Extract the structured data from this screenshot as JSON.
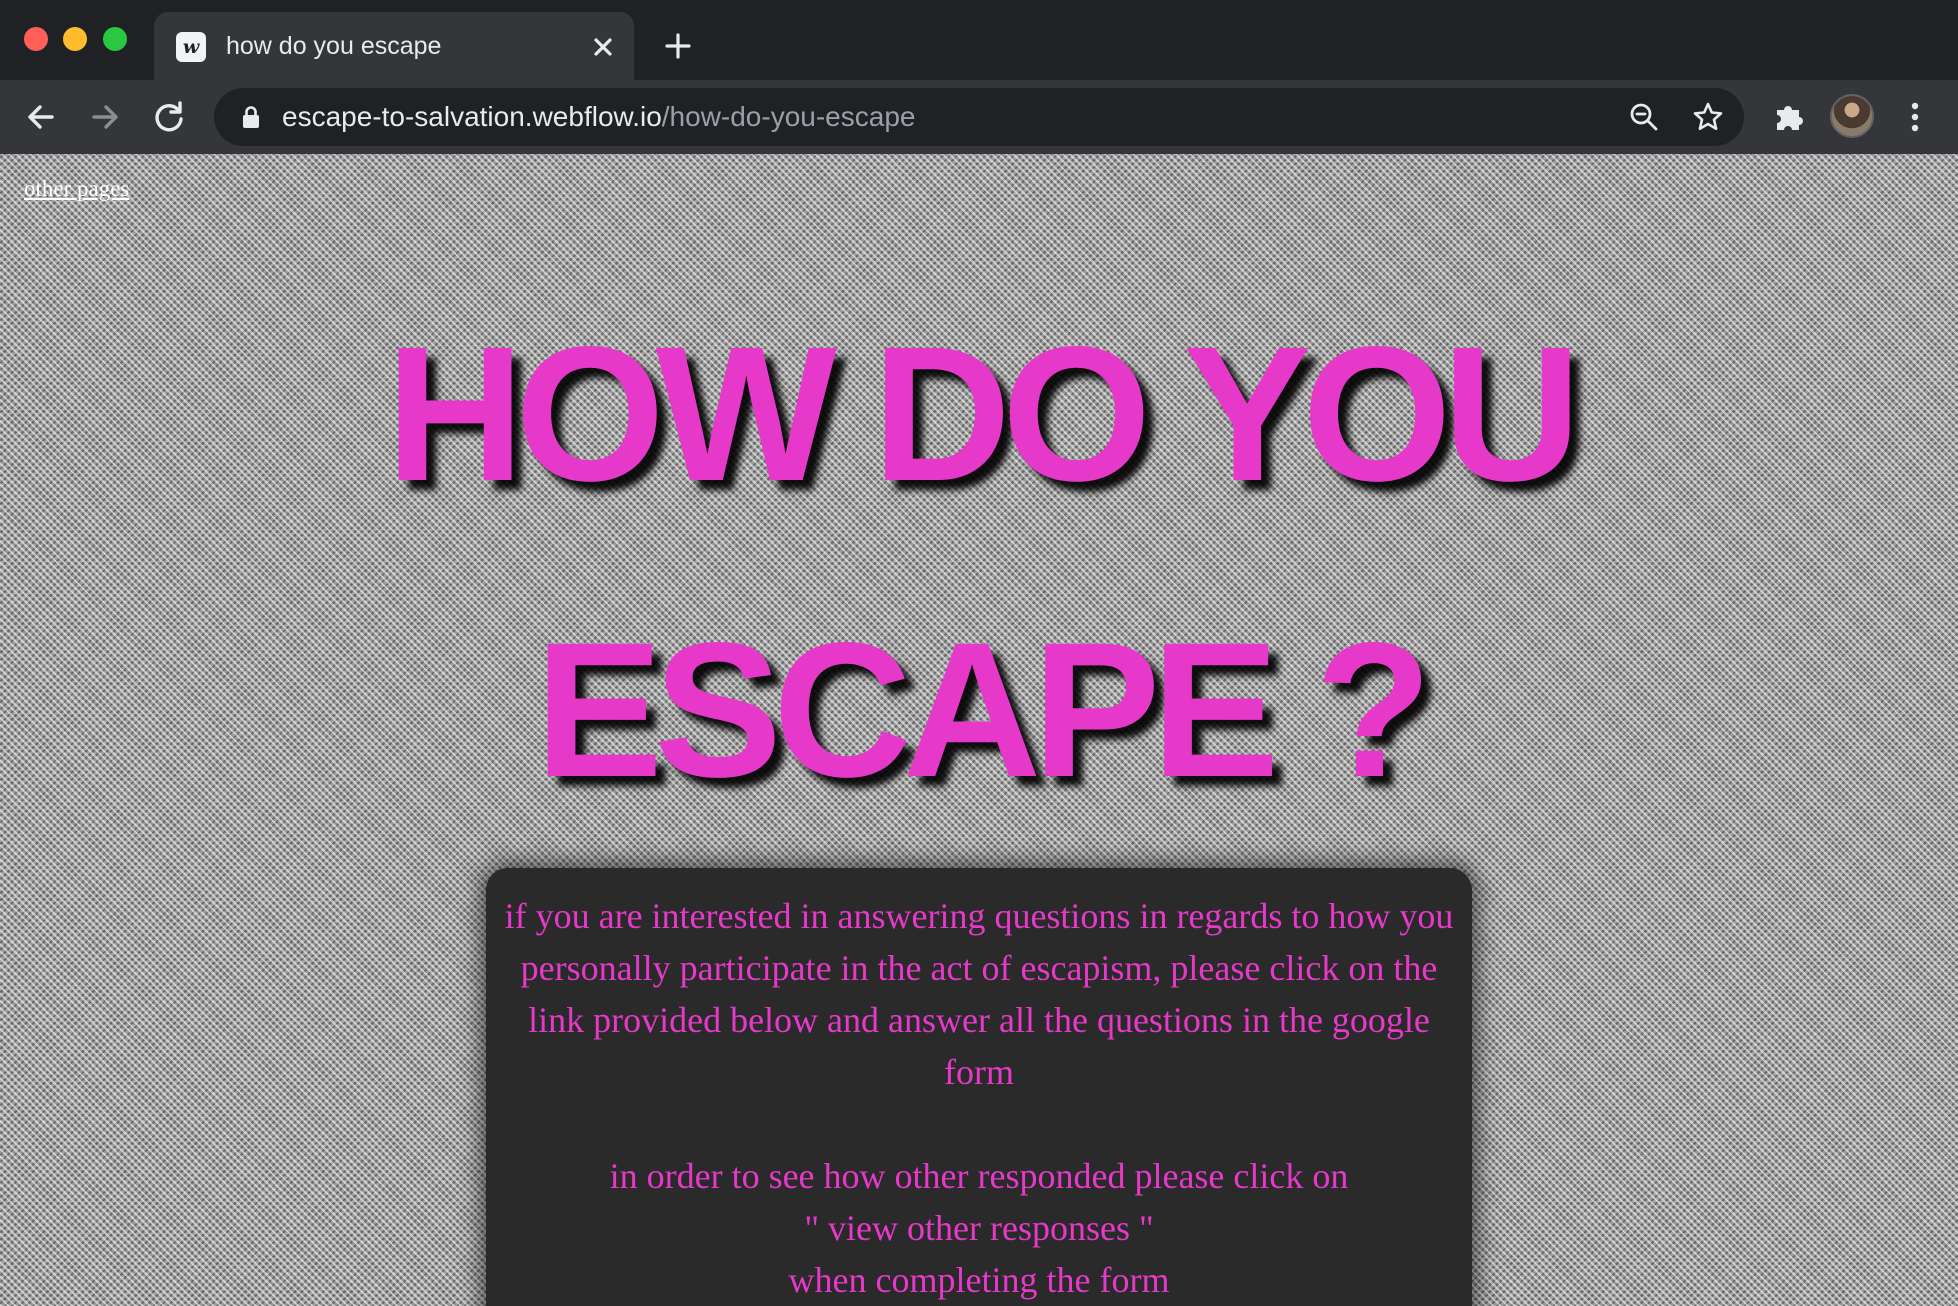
{
  "browser": {
    "tab_title": "how do you escape",
    "tab_favicon": "w",
    "url_host": "escape-to-salvation.webflow.io",
    "url_path": "/how-do-you-escape",
    "icons": [
      "back-arrow-icon",
      "forward-arrow-icon",
      "reload-icon",
      "lock-icon",
      "zoom-icon",
      "star-icon",
      "puzzle-extension-icon",
      "profile-avatar",
      "more-vertical-icon",
      "close-icon",
      "plus-icon"
    ]
  },
  "page": {
    "nav_link": "other pages",
    "headline_line1": "HOW DO YOU",
    "headline_line2": "ESCAPE ?",
    "accent_color": "#e639c9",
    "card": {
      "paragraph1": "if you are interested in answering questions in regards to how you personally participate in the act of escapism, please click on the link provided below and answer all the questions in the google form",
      "paragraph2_line1": "in order to see how other responded please click on",
      "paragraph2_line2": "\" view other responses \"",
      "paragraph2_line3": "when completing the form"
    }
  }
}
